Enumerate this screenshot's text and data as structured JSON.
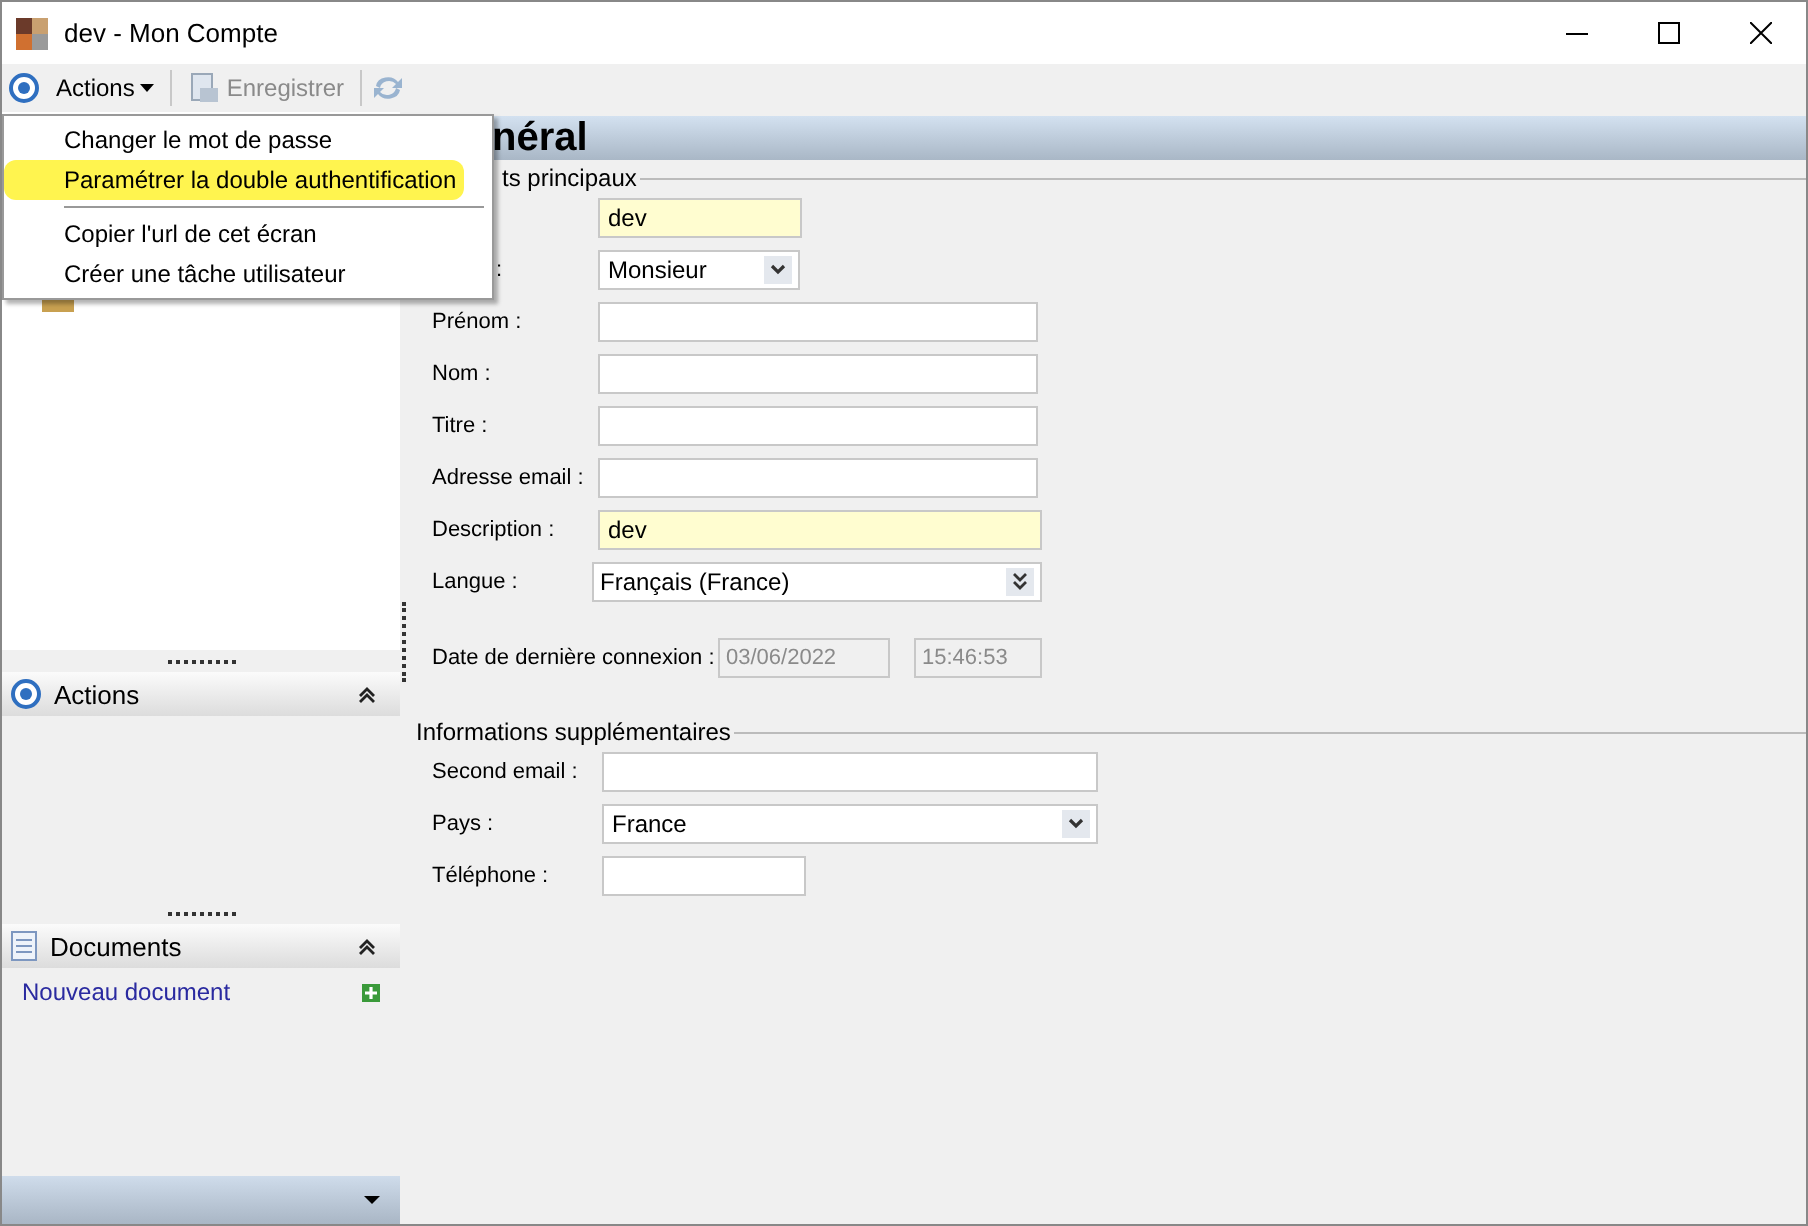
{
  "window": {
    "title": "dev -  Mon Compte"
  },
  "toolbar": {
    "actions_label": "Actions",
    "save": {
      "label": "Enregistrer",
      "disabled": true
    }
  },
  "actions_menu": {
    "groups": [
      [
        {
          "label": "Changer le mot de passe",
          "selected": false
        },
        {
          "label": "Paramétrer la double authentification",
          "selected": true
        }
      ],
      [
        {
          "label": "Copier l'url de cet écran",
          "selected": false
        },
        {
          "label": "Créer une tâche utilisateur",
          "selected": false
        }
      ]
    ]
  },
  "sidebar": {
    "panels": [
      {
        "title": "Actions",
        "kind": "actions",
        "expanded": true
      },
      {
        "title": "Documents",
        "kind": "documents",
        "expanded": true,
        "links": [
          {
            "label": "Nouveau document"
          }
        ]
      }
    ]
  },
  "main": {
    "header": "néral",
    "sections": [
      {
        "title": "ts principaux",
        "rows": [
          {
            "kind": "text",
            "value": "dev",
            "required": true
          },
          {
            "kind": "combo",
            "label": ":",
            "label_cut": true,
            "value": "Monsieur"
          },
          {
            "kind": "text",
            "label": "Prénom :",
            "required": false
          },
          {
            "kind": "text",
            "label": "Nom :",
            "required": false
          },
          {
            "kind": "text",
            "label": "Titre :",
            "required": false
          },
          {
            "kind": "text",
            "label": "Adresse email :",
            "required": false
          },
          {
            "kind": "text",
            "label": "Description :",
            "value": "dev",
            "required": true
          },
          {
            "kind": "dropdown",
            "label": "Langue :",
            "value": "Français (France)"
          },
          {
            "kind": "datetime",
            "label": "Date de dernière connexion :",
            "date": "03/06/2022",
            "time": "15:46:53",
            "disabled": true
          }
        ]
      },
      {
        "title": "Informations supplémentaires",
        "rows": [
          {
            "kind": "text",
            "label": "Second email :",
            "required": false
          },
          {
            "kind": "combo",
            "label": "Pays :",
            "value": "France"
          },
          {
            "kind": "short",
            "label": "Téléphone :",
            "required": false
          }
        ]
      }
    ]
  }
}
